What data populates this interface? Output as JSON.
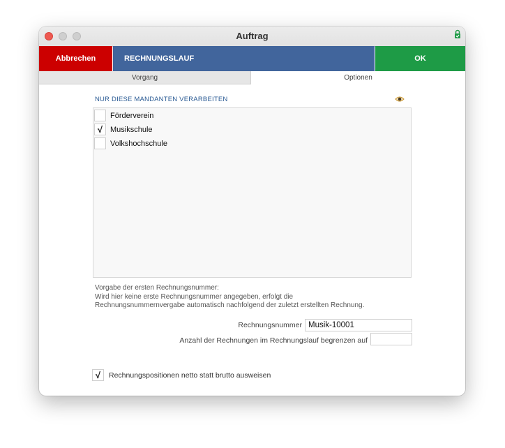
{
  "window": {
    "title": "Auftrag"
  },
  "actionbar": {
    "cancel_label": "Abbrechen",
    "title": "RECHNUNGSLAUF",
    "ok_label": "OK"
  },
  "tabs": [
    {
      "label": "Vorgang",
      "active": false
    },
    {
      "label": "Optionen",
      "active": true
    }
  ],
  "mandanten": {
    "section_label": "NUR DIESE MANDANTEN VERARBEITEN",
    "items": [
      {
        "label": "Förderverein",
        "checked": false,
        "mark": ""
      },
      {
        "label": "Musikschule",
        "checked": true,
        "mark": "√"
      },
      {
        "label": "Volkshochschule",
        "checked": false,
        "mark": ""
      }
    ]
  },
  "hint": {
    "line1": "Vorgabe der ersten Rechnungsnummer:",
    "line2": "Wird hier keine erste Rechnungsnummer angegeben, erfolgt die",
    "line3": "Rechnungsnummernvergabe automatisch nachfolgend der zuletzt erstellten Rechnung."
  },
  "fields": {
    "rechnungsnummer_label": "Rechnungsnummer",
    "rechnungsnummer_value": "Musik-10001",
    "limit_label": "Anzahl der Rechnungen im Rechnungslauf begrenzen auf",
    "limit_value": ""
  },
  "netto": {
    "label": "Rechnungspositionen netto statt brutto ausweisen",
    "checked": true,
    "mark": "√"
  },
  "colors": {
    "cancel": "#cc0000",
    "title_bar": "#41659c",
    "ok": "#1e9b46",
    "section_label": "#2b5b94"
  },
  "icons": {
    "lock": "lock-icon",
    "eye": "eye-icon"
  }
}
